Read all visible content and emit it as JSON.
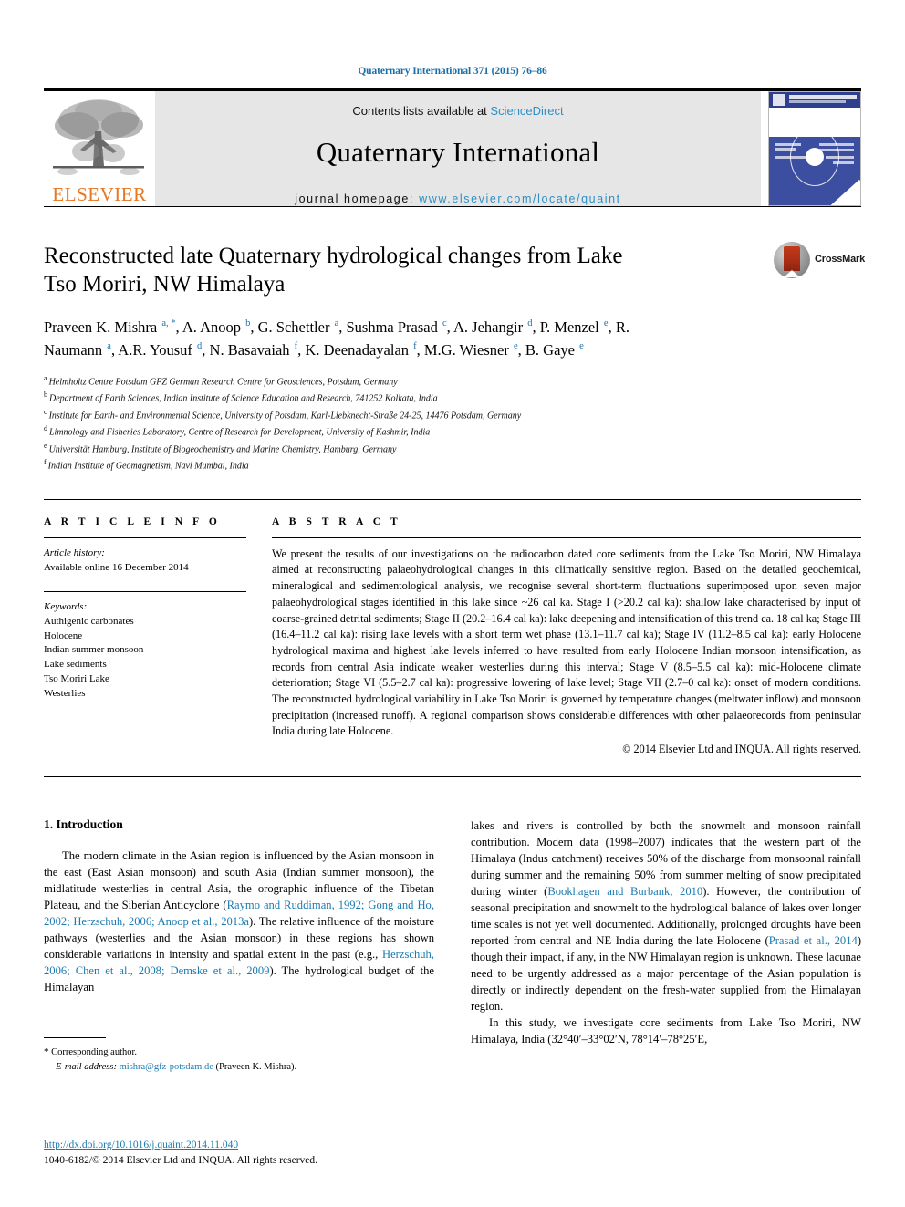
{
  "running_head": "Quaternary International 371 (2015) 76–86",
  "masthead": {
    "contents_prefix": "Contents lists available at ",
    "sciencedirect": "ScienceDirect",
    "journal_title": "Quaternary International",
    "homepage_label": "journal homepage: ",
    "homepage_url": "www.elsevier.com/locate/quaint",
    "publisher": "ELSEVIER"
  },
  "article": {
    "title": "Reconstructed late Quaternary hydrological changes from Lake Tso Moriri, NW Himalaya",
    "crossmark_label": "CrossMark",
    "authors_html": "Praveen K. Mishra <sup>a, *</sup>, A. Anoop <sup>b</sup>, G. Schettler <sup>a</sup>, Sushma Prasad <sup>c</sup>, A. Jehangir <sup>d</sup>, P. Menzel <sup>e</sup>, R. Naumann <sup>a</sup>, A.R. Yousuf <sup>d</sup>, N. Basavaiah <sup>f</sup>, K. Deenadayalan <sup>f</sup>, M.G. Wiesner <sup>e</sup>, B. Gaye <sup>e</sup>",
    "affiliations": [
      {
        "marker": "a",
        "text": "Helmholtz Centre Potsdam GFZ German Research Centre for Geosciences, Potsdam, Germany"
      },
      {
        "marker": "b",
        "text": "Department of Earth Sciences, Indian Institute of Science Education and Research, 741252 Kolkata, India"
      },
      {
        "marker": "c",
        "text": "Institute for Earth- and Environmental Science, University of Potsdam, Karl-Liebknecht-Straße 24-25, 14476 Potsdam, Germany"
      },
      {
        "marker": "d",
        "text": "Limnology and Fisheries Laboratory, Centre of Research for Development, University of Kashmir, India"
      },
      {
        "marker": "e",
        "text": "Universität Hamburg, Institute of Biogeochemistry and Marine Chemistry, Hamburg, Germany"
      },
      {
        "marker": "f",
        "text": "Indian Institute of Geomagnetism, Navi Mumbai, India"
      }
    ]
  },
  "article_info": {
    "heading": "A R T I C L E   I N F O",
    "history_label": "Article history:",
    "history_value": "Available online 16 December 2014",
    "keywords_label": "Keywords:",
    "keywords": [
      "Authigenic carbonates",
      "Holocene",
      "Indian summer monsoon",
      "Lake sediments",
      "Tso Moriri Lake",
      "Westerlies"
    ]
  },
  "abstract": {
    "heading": "A B S T R A C T",
    "body": "We present the results of our investigations on the radiocarbon dated core sediments from the Lake Tso Moriri, NW Himalaya aimed at reconstructing palaeohydrological changes in this climatically sensitive region. Based on the detailed geochemical, mineralogical and sedimentological analysis, we recognise several short-term fluctuations superimposed upon seven major palaeohydrological stages identified in this lake since ~26 cal ka. Stage I (>20.2 cal ka): shallow lake characterised by input of coarse-grained detrital sediments; Stage II (20.2–16.4 cal ka): lake deepening and intensification of this trend ca. 18 cal ka; Stage III (16.4–11.2 cal ka): rising lake levels with a short term wet phase (13.1–11.7 cal ka); Stage IV (11.2–8.5 cal ka): early Holocene hydrological maxima and highest lake levels inferred to have resulted from early Holocene Indian monsoon intensification, as records from central Asia indicate weaker westerlies during this interval; Stage V (8.5–5.5 cal ka): mid-Holocene climate deterioration; Stage VI (5.5–2.7 cal ka): progressive lowering of lake level; Stage VII (2.7–0 cal ka): onset of modern conditions. The reconstructed hydrological variability in Lake Tso Moriri is governed by temperature changes (meltwater inflow) and monsoon precipitation (increased runoff). A regional comparison shows considerable differences with other palaeorecords from peninsular India during late Holocene.",
    "copyright": "© 2014 Elsevier Ltd and INQUA. All rights reserved."
  },
  "introduction": {
    "heading": "1. Introduction",
    "left_paragraph_html": "The modern climate in the Asian region is influenced by the Asian monsoon in the east (East Asian monsoon) and south Asia (Indian summer monsoon), the midlatitude westerlies in central Asia, the orographic influence of the Tibetan Plateau, and the Siberian Anticyclone (<span class=\"ref\">Raymo and Ruddiman, 1992; Gong and Ho, 2002; Herzschuh, 2006; Anoop et al., 2013a</span>). The relative influence of the moisture pathways (westerlies and the Asian monsoon) in these regions has shown considerable variations in intensity and spatial extent in the past (e.g., <span class=\"ref\">Herzschuh, 2006; Chen et al., 2008; Demske et al., 2009</span>). The hydrological budget of the Himalayan",
    "right_paragraph1_html": "lakes and rivers is controlled by both the snowmelt and monsoon rainfall contribution. Modern data (1998–2007) indicates that the western part of the Himalaya (Indus catchment) receives 50% of the discharge from monsoonal rainfall during summer and the remaining 50% from summer melting of snow precipitated during winter (<span class=\"ref\">Bookhagen and Burbank, 2010</span>). However, the contribution of seasonal precipitation and snowmelt to the hydrological balance of lakes over longer time scales is not yet well documented. Additionally, prolonged droughts have been reported from central and NE India during the late Holocene (<span class=\"ref\">Prasad et al., 2014</span>) though their impact, if any, in the NW Himalayan region is unknown. These lacunae need to be urgently addressed as a major percentage of the Asian population is directly or indirectly dependent on the fresh-water supplied from the Himalayan region.",
    "right_paragraph2_html": "In this study, we investigate core sediments from Lake Tso Moriri, NW Himalaya, India (32°40′–33°02′N, 78°14′–78°25′E,"
  },
  "footer": {
    "corresponding_marker": "*",
    "corresponding_label": "Corresponding author.",
    "email_label": "E-mail address:",
    "email": "mishra@gfz-potsdam.de",
    "email_owner": "(Praveen K. Mishra).",
    "doi_url": "http://dx.doi.org/10.1016/j.quaint.2014.11.040",
    "issn_line": "1040-6182/© 2014 Elsevier Ltd and INQUA. All rights reserved."
  }
}
